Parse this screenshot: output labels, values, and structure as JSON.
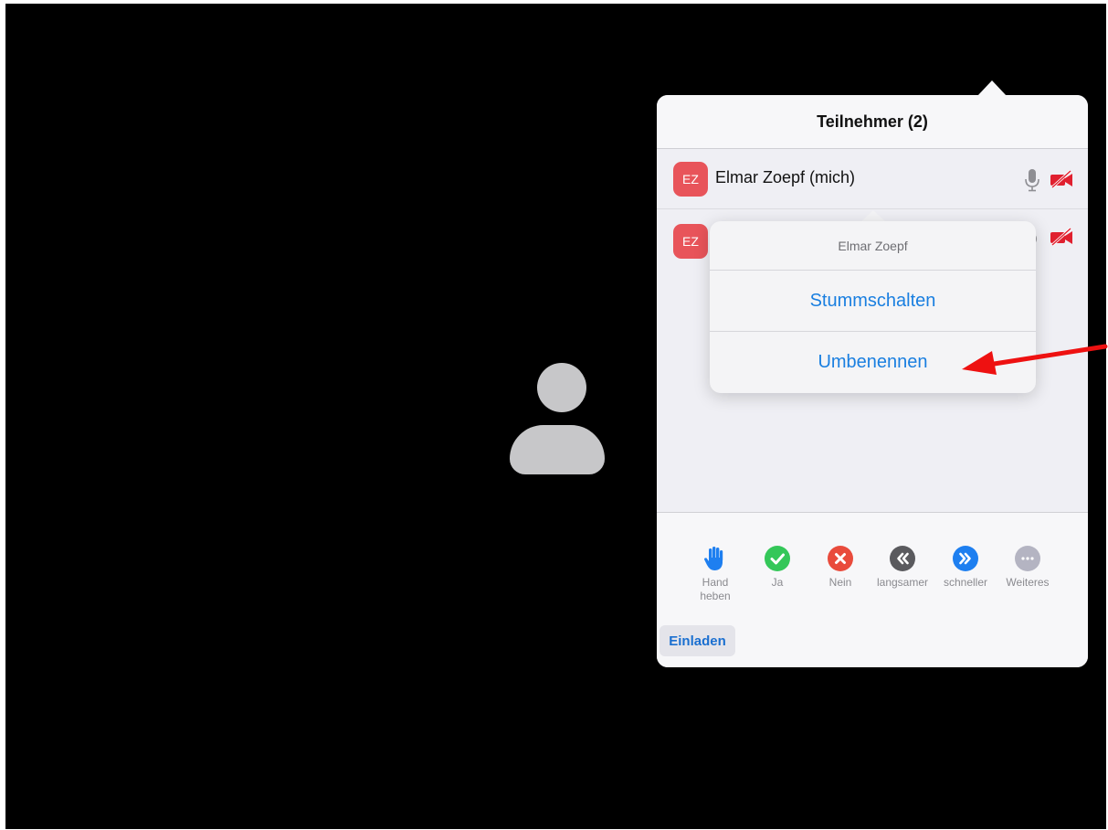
{
  "panel": {
    "title": "Teilnehmer (2)",
    "participants": [
      {
        "initials": "EZ",
        "name": "Elmar Zoepf (mich)",
        "mic": "mic-icon",
        "video": "video-off-icon"
      },
      {
        "initials": "EZ",
        "name": "",
        "video": "video-off-icon"
      }
    ]
  },
  "popover": {
    "title": "Elmar Zoepf",
    "actions": [
      "Stummschalten",
      "Umbenennen"
    ]
  },
  "reactions": [
    {
      "label": "Hand heben",
      "icon": "raise-hand-icon"
    },
    {
      "label": "Ja",
      "icon": "check-icon"
    },
    {
      "label": "Nein",
      "icon": "x-icon"
    },
    {
      "label": "langsamer",
      "icon": "slower-icon"
    },
    {
      "label": "schneller",
      "icon": "faster-icon"
    },
    {
      "label": "Weiteres",
      "icon": "more-icon"
    }
  ],
  "invite_label": "Einladen",
  "colors": {
    "accent": "#1a7fe0",
    "avatar_bg": "#e8545a",
    "yes": "#34c759",
    "no": "#e94b3c",
    "slower": "#5a5a5e",
    "faster": "#1e7ff0",
    "more": "#b4b4c2",
    "annotation_arrow": "#ee1111"
  }
}
